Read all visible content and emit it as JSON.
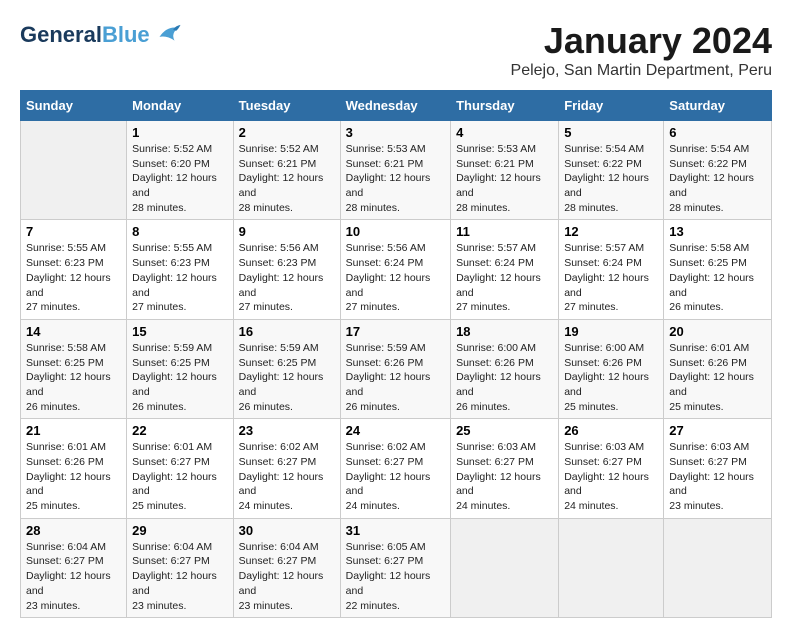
{
  "logo": {
    "line1": "General",
    "line2": "Blue"
  },
  "title": "January 2024",
  "subtitle": "Pelejo, San Martin Department, Peru",
  "days_of_week": [
    "Sunday",
    "Monday",
    "Tuesday",
    "Wednesday",
    "Thursday",
    "Friday",
    "Saturday"
  ],
  "weeks": [
    [
      {
        "day": "",
        "sunrise": "",
        "sunset": "",
        "daylight": ""
      },
      {
        "day": "1",
        "sunrise": "Sunrise: 5:52 AM",
        "sunset": "Sunset: 6:20 PM",
        "daylight": "Daylight: 12 hours and 28 minutes."
      },
      {
        "day": "2",
        "sunrise": "Sunrise: 5:52 AM",
        "sunset": "Sunset: 6:21 PM",
        "daylight": "Daylight: 12 hours and 28 minutes."
      },
      {
        "day": "3",
        "sunrise": "Sunrise: 5:53 AM",
        "sunset": "Sunset: 6:21 PM",
        "daylight": "Daylight: 12 hours and 28 minutes."
      },
      {
        "day": "4",
        "sunrise": "Sunrise: 5:53 AM",
        "sunset": "Sunset: 6:21 PM",
        "daylight": "Daylight: 12 hours and 28 minutes."
      },
      {
        "day": "5",
        "sunrise": "Sunrise: 5:54 AM",
        "sunset": "Sunset: 6:22 PM",
        "daylight": "Daylight: 12 hours and 28 minutes."
      },
      {
        "day": "6",
        "sunrise": "Sunrise: 5:54 AM",
        "sunset": "Sunset: 6:22 PM",
        "daylight": "Daylight: 12 hours and 28 minutes."
      }
    ],
    [
      {
        "day": "7",
        "sunrise": "Sunrise: 5:55 AM",
        "sunset": "Sunset: 6:23 PM",
        "daylight": "Daylight: 12 hours and 27 minutes."
      },
      {
        "day": "8",
        "sunrise": "Sunrise: 5:55 AM",
        "sunset": "Sunset: 6:23 PM",
        "daylight": "Daylight: 12 hours and 27 minutes."
      },
      {
        "day": "9",
        "sunrise": "Sunrise: 5:56 AM",
        "sunset": "Sunset: 6:23 PM",
        "daylight": "Daylight: 12 hours and 27 minutes."
      },
      {
        "day": "10",
        "sunrise": "Sunrise: 5:56 AM",
        "sunset": "Sunset: 6:24 PM",
        "daylight": "Daylight: 12 hours and 27 minutes."
      },
      {
        "day": "11",
        "sunrise": "Sunrise: 5:57 AM",
        "sunset": "Sunset: 6:24 PM",
        "daylight": "Daylight: 12 hours and 27 minutes."
      },
      {
        "day": "12",
        "sunrise": "Sunrise: 5:57 AM",
        "sunset": "Sunset: 6:24 PM",
        "daylight": "Daylight: 12 hours and 27 minutes."
      },
      {
        "day": "13",
        "sunrise": "Sunrise: 5:58 AM",
        "sunset": "Sunset: 6:25 PM",
        "daylight": "Daylight: 12 hours and 26 minutes."
      }
    ],
    [
      {
        "day": "14",
        "sunrise": "Sunrise: 5:58 AM",
        "sunset": "Sunset: 6:25 PM",
        "daylight": "Daylight: 12 hours and 26 minutes."
      },
      {
        "day": "15",
        "sunrise": "Sunrise: 5:59 AM",
        "sunset": "Sunset: 6:25 PM",
        "daylight": "Daylight: 12 hours and 26 minutes."
      },
      {
        "day": "16",
        "sunrise": "Sunrise: 5:59 AM",
        "sunset": "Sunset: 6:25 PM",
        "daylight": "Daylight: 12 hours and 26 minutes."
      },
      {
        "day": "17",
        "sunrise": "Sunrise: 5:59 AM",
        "sunset": "Sunset: 6:26 PM",
        "daylight": "Daylight: 12 hours and 26 minutes."
      },
      {
        "day": "18",
        "sunrise": "Sunrise: 6:00 AM",
        "sunset": "Sunset: 6:26 PM",
        "daylight": "Daylight: 12 hours and 26 minutes."
      },
      {
        "day": "19",
        "sunrise": "Sunrise: 6:00 AM",
        "sunset": "Sunset: 6:26 PM",
        "daylight": "Daylight: 12 hours and 25 minutes."
      },
      {
        "day": "20",
        "sunrise": "Sunrise: 6:01 AM",
        "sunset": "Sunset: 6:26 PM",
        "daylight": "Daylight: 12 hours and 25 minutes."
      }
    ],
    [
      {
        "day": "21",
        "sunrise": "Sunrise: 6:01 AM",
        "sunset": "Sunset: 6:26 PM",
        "daylight": "Daylight: 12 hours and 25 minutes."
      },
      {
        "day": "22",
        "sunrise": "Sunrise: 6:01 AM",
        "sunset": "Sunset: 6:27 PM",
        "daylight": "Daylight: 12 hours and 25 minutes."
      },
      {
        "day": "23",
        "sunrise": "Sunrise: 6:02 AM",
        "sunset": "Sunset: 6:27 PM",
        "daylight": "Daylight: 12 hours and 24 minutes."
      },
      {
        "day": "24",
        "sunrise": "Sunrise: 6:02 AM",
        "sunset": "Sunset: 6:27 PM",
        "daylight": "Daylight: 12 hours and 24 minutes."
      },
      {
        "day": "25",
        "sunrise": "Sunrise: 6:03 AM",
        "sunset": "Sunset: 6:27 PM",
        "daylight": "Daylight: 12 hours and 24 minutes."
      },
      {
        "day": "26",
        "sunrise": "Sunrise: 6:03 AM",
        "sunset": "Sunset: 6:27 PM",
        "daylight": "Daylight: 12 hours and 24 minutes."
      },
      {
        "day": "27",
        "sunrise": "Sunrise: 6:03 AM",
        "sunset": "Sunset: 6:27 PM",
        "daylight": "Daylight: 12 hours and 23 minutes."
      }
    ],
    [
      {
        "day": "28",
        "sunrise": "Sunrise: 6:04 AM",
        "sunset": "Sunset: 6:27 PM",
        "daylight": "Daylight: 12 hours and 23 minutes."
      },
      {
        "day": "29",
        "sunrise": "Sunrise: 6:04 AM",
        "sunset": "Sunset: 6:27 PM",
        "daylight": "Daylight: 12 hours and 23 minutes."
      },
      {
        "day": "30",
        "sunrise": "Sunrise: 6:04 AM",
        "sunset": "Sunset: 6:27 PM",
        "daylight": "Daylight: 12 hours and 23 minutes."
      },
      {
        "day": "31",
        "sunrise": "Sunrise: 6:05 AM",
        "sunset": "Sunset: 6:27 PM",
        "daylight": "Daylight: 12 hours and 22 minutes."
      },
      {
        "day": "",
        "sunrise": "",
        "sunset": "",
        "daylight": ""
      },
      {
        "day": "",
        "sunrise": "",
        "sunset": "",
        "daylight": ""
      },
      {
        "day": "",
        "sunrise": "",
        "sunset": "",
        "daylight": ""
      }
    ]
  ]
}
